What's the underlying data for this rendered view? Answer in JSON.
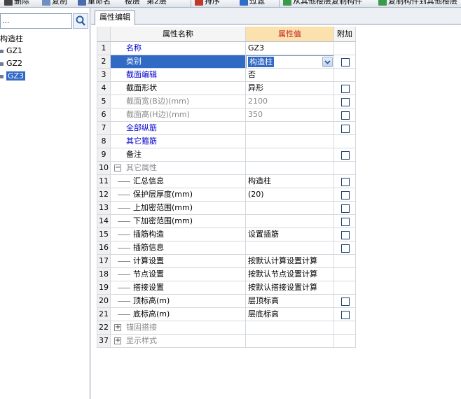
{
  "toolbar": {
    "items": [
      "删除",
      "复制",
      "重命名",
      "楼层",
      "第2层",
      "排序",
      "过滤",
      "从其他楼层复制构件",
      "复制构件到其他楼层"
    ]
  },
  "left": {
    "search_placeholder": "...",
    "tree": [
      {
        "label": "构造柱"
      },
      {
        "label": "GZ1"
      },
      {
        "label": "GZ2"
      },
      {
        "label": "GZ3"
      }
    ]
  },
  "tab": {
    "label": "属性编辑"
  },
  "grid": {
    "headers": {
      "name": "属性名称",
      "value": "属性值",
      "extra": "附加"
    },
    "rows": [
      {
        "num": "1",
        "name": "名称",
        "value": "GZ3",
        "style": "blue",
        "checkbox": false,
        "indent": false
      },
      {
        "num": "2",
        "name": "类别",
        "value": "构造柱",
        "style": "blue",
        "checkbox": true,
        "indent": false,
        "selected": true,
        "combo": true
      },
      {
        "num": "3",
        "name": "截面编辑",
        "value": "否",
        "style": "blue",
        "checkbox": false,
        "indent": false
      },
      {
        "num": "4",
        "name": "截面形状",
        "value": "异形",
        "style": "black",
        "checkbox": true,
        "indent": false
      },
      {
        "num": "5",
        "name": "截面宽(B边)(mm)",
        "value": "2100",
        "style": "gray",
        "checkbox": true,
        "indent": false
      },
      {
        "num": "6",
        "name": "截面高(H边)(mm)",
        "value": "350",
        "style": "gray",
        "checkbox": true,
        "indent": false
      },
      {
        "num": "7",
        "name": "全部纵筋",
        "value": "",
        "style": "blue",
        "checkbox": true,
        "indent": false
      },
      {
        "num": "8",
        "name": "其它箍筋",
        "value": "",
        "style": "blue",
        "checkbox": false,
        "indent": false
      },
      {
        "num": "9",
        "name": "备注",
        "value": "",
        "style": "black",
        "checkbox": true,
        "indent": false
      },
      {
        "num": "10",
        "name": "其它属性",
        "value": "",
        "style": "gray",
        "checkbox": false,
        "indent": false,
        "expander": "−"
      },
      {
        "num": "11",
        "name": "汇总信息",
        "value": "构造柱",
        "style": "black",
        "checkbox": true,
        "indent": true
      },
      {
        "num": "12",
        "name": "保护层厚度(mm)",
        "value": "(20)",
        "style": "black",
        "checkbox": true,
        "indent": true
      },
      {
        "num": "13",
        "name": "上加密范围(mm)",
        "value": "",
        "style": "black",
        "checkbox": true,
        "indent": true
      },
      {
        "num": "14",
        "name": "下加密范围(mm)",
        "value": "",
        "style": "black",
        "checkbox": true,
        "indent": true
      },
      {
        "num": "15",
        "name": "插筋构造",
        "value": "设置插筋",
        "style": "black",
        "checkbox": true,
        "indent": true
      },
      {
        "num": "16",
        "name": "插筋信息",
        "value": "",
        "style": "black",
        "checkbox": true,
        "indent": true
      },
      {
        "num": "17",
        "name": "计算设置",
        "value": "按默认计算设置计算",
        "style": "black",
        "checkbox": false,
        "indent": true
      },
      {
        "num": "18",
        "name": "节点设置",
        "value": "按默认节点设置计算",
        "style": "black",
        "checkbox": false,
        "indent": true
      },
      {
        "num": "19",
        "name": "搭接设置",
        "value": "按默认搭接设置计算",
        "style": "black",
        "checkbox": false,
        "indent": true
      },
      {
        "num": "20",
        "name": "顶标高(m)",
        "value": "层顶标高",
        "style": "black",
        "checkbox": true,
        "indent": true
      },
      {
        "num": "21",
        "name": "底标高(m)",
        "value": "层底标高",
        "style": "black",
        "checkbox": true,
        "indent": true
      },
      {
        "num": "22",
        "name": "锚固搭接",
        "value": "",
        "style": "gray",
        "checkbox": false,
        "indent": false,
        "expander": "+"
      },
      {
        "num": "37",
        "name": "显示样式",
        "value": "",
        "style": "gray",
        "checkbox": false,
        "indent": false,
        "expander": "+"
      }
    ]
  },
  "colors": {
    "selection": "#316ac5",
    "value_header": "#fbe1ae",
    "link_blue": "#0000cc"
  }
}
